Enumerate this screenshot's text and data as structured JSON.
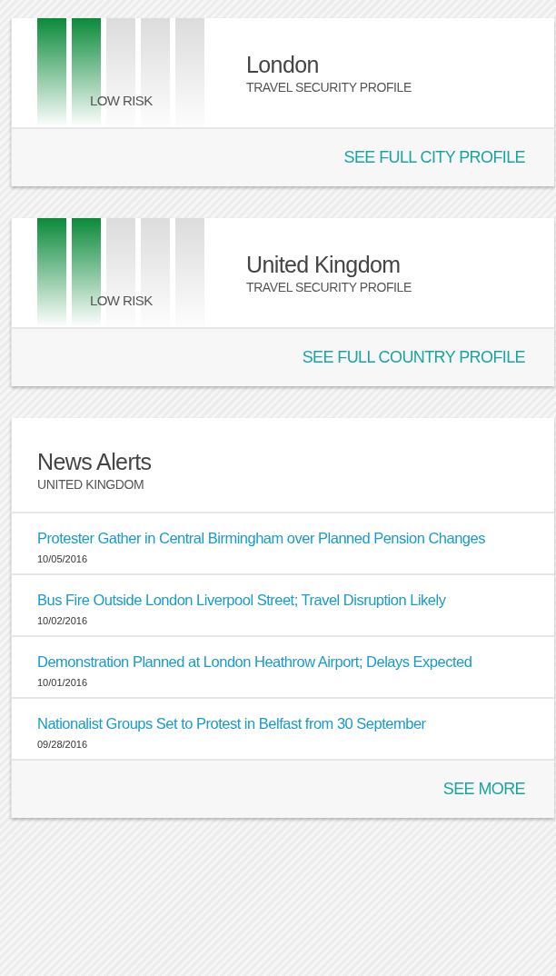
{
  "profiles": [
    {
      "title": "London",
      "subtitle": "TRAVEL SECURITY PROFILE",
      "risk_label": "LOW RISK",
      "bars": [
        {
          "filled": true
        },
        {
          "filled": true
        },
        {
          "filled": false
        },
        {
          "filled": false
        },
        {
          "filled": false
        }
      ],
      "link": "SEE FULL CITY PROFILE"
    },
    {
      "title": "United Kingdom",
      "subtitle": "TRAVEL SECURITY PROFILE",
      "risk_label": "LOW RISK",
      "bars": [
        {
          "filled": true
        },
        {
          "filled": true
        },
        {
          "filled": false
        },
        {
          "filled": false
        },
        {
          "filled": false
        }
      ],
      "link": "SEE FULL COUNTRY PROFILE"
    }
  ],
  "news": {
    "title": "News Alerts",
    "subtitle": "UNITED KINGDOM",
    "items": [
      {
        "headline": "Protester Gather in Central Birmingham over Planned Pension Changes",
        "date": "10/05/2016"
      },
      {
        "headline": "Bus Fire Outside London Liverpool Street; Travel Disruption Likely",
        "date": "10/02/2016"
      },
      {
        "headline": "Demonstration Planned at London Heathrow Airport; Delays Expected",
        "date": "10/01/2016"
      },
      {
        "headline": "Nationalist Groups Set to Protest in Belfast from 30 September",
        "date": "09/28/2016"
      }
    ],
    "more": "SEE MORE"
  }
}
